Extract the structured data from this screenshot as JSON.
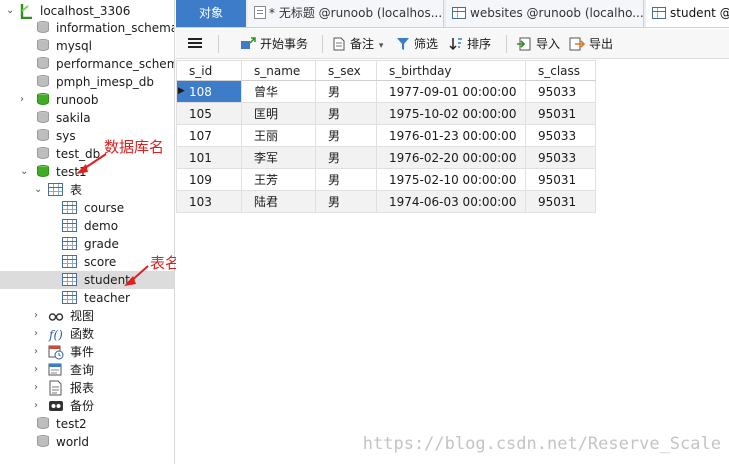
{
  "tree": {
    "connection": "localhost_3306",
    "databases_top": [
      "information_schema",
      "mysql",
      "performance_schema",
      "pmph_imesp_db",
      "runoob",
      "sakila",
      "sys",
      "test_db"
    ],
    "open_db": "test1",
    "tables_folder": "表",
    "tables": [
      "course",
      "demo",
      "grade",
      "score",
      "student",
      "teacher"
    ],
    "selected_table": "student",
    "folders": [
      "视图",
      "函数",
      "事件",
      "查询",
      "报表",
      "备份"
    ],
    "databases_bottom": [
      "test2",
      "world"
    ]
  },
  "annotations": {
    "db_name": "数据库名",
    "table_name": "表名"
  },
  "tabs": {
    "objects": "对象",
    "tab1": "* 无标题 @runoob (localhos...",
    "tab2": "websites @runoob (localho...",
    "tab3": "student @"
  },
  "toolbar": {
    "begin_tx": "开始事务",
    "memo": "备注",
    "filter": "筛选",
    "sort": "排序",
    "import": "导入",
    "export": "导出"
  },
  "grid": {
    "columns": [
      "s_id",
      "s_name",
      "s_sex",
      "s_birthday",
      "s_class"
    ],
    "rows": [
      [
        "108",
        "曾华",
        "男",
        "1977-09-01 00:00:00",
        "95033"
      ],
      [
        "105",
        "匡明",
        "男",
        "1975-10-02 00:00:00",
        "95031"
      ],
      [
        "107",
        "王丽",
        "男",
        "1976-01-23 00:00:00",
        "95033"
      ],
      [
        "101",
        "李军",
        "男",
        "1976-02-20 00:00:00",
        "95033"
      ],
      [
        "109",
        "王芳",
        "男",
        "1975-02-10 00:00:00",
        "95031"
      ],
      [
        "103",
        "陆君",
        "男",
        "1974-06-03 00:00:00",
        "95031"
      ]
    ]
  },
  "watermark": "https://blog.csdn.net/Reserve_Scale",
  "colors": {
    "accent": "#3d7cc9",
    "annotation": "#e02020",
    "db_active": "#3fae26"
  }
}
